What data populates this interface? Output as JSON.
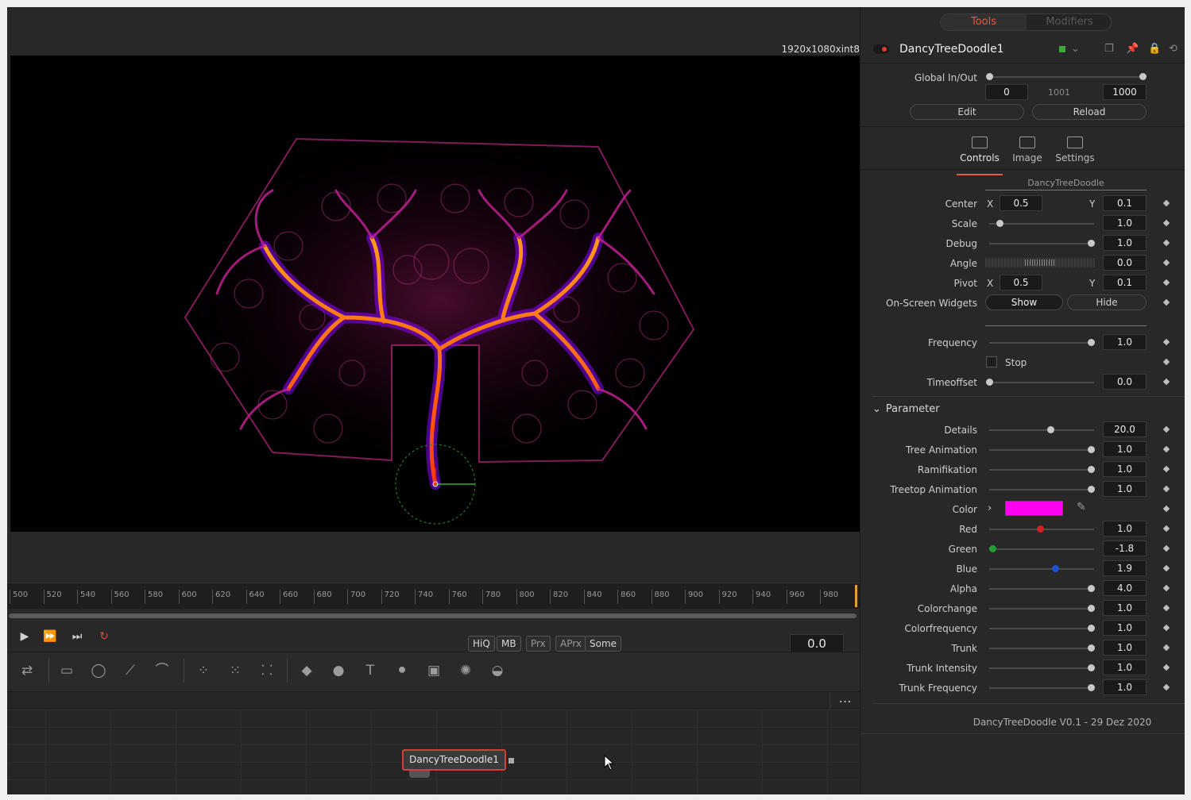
{
  "viewer": {
    "resolution": "1920x1080xint8",
    "ruler_ticks": [
      "500",
      "520",
      "540",
      "560",
      "580",
      "600",
      "620",
      "640",
      "660",
      "680",
      "700",
      "720",
      "740",
      "760",
      "780",
      "800",
      "820",
      "840",
      "860",
      "880",
      "900",
      "920",
      "940",
      "960",
      "980"
    ]
  },
  "transport": {
    "play_icon": "play-icon",
    "chips": [
      "HiQ",
      "MB",
      "Prx",
      "APrx",
      "Some"
    ],
    "time_value": "0.0"
  },
  "node": {
    "label": "DancyTreeDoodle1"
  },
  "inspector": {
    "tabs": {
      "tools": "Tools",
      "modifiers": "Modifiers"
    },
    "tool_name": "DancyTreeDoodle1",
    "global_inout": {
      "label": "Global In/Out",
      "start": "0",
      "mid": "1001",
      "end": "1000",
      "edit": "Edit",
      "reload": "Reload"
    },
    "subtabs": {
      "controls": "Controls",
      "image": "Image",
      "settings": "Settings"
    },
    "section_title": "DancyTreeDoodle",
    "center": {
      "label": "Center",
      "x_label": "X",
      "x": "0.5",
      "y_label": "Y",
      "y": "0.1"
    },
    "scale": {
      "label": "Scale",
      "value": "1.0",
      "level": 0.1
    },
    "debug": {
      "label": "Debug",
      "value": "1.0",
      "level": 1.0
    },
    "angle": {
      "label": "Angle",
      "value": "0.0"
    },
    "pivot": {
      "label": "Pivot",
      "x_label": "X",
      "x": "0.5",
      "y_label": "Y",
      "y": "0.1"
    },
    "widgets": {
      "label": "On-Screen Widgets",
      "show": "Show",
      "hide": "Hide"
    },
    "frequency": {
      "label": "Frequency",
      "value": "1.0",
      "level": 1.0
    },
    "stop": {
      "label": "Stop"
    },
    "timeoffset": {
      "label": "Timeoffset",
      "value": "0.0",
      "level": 0.0
    },
    "parameter_title": "Parameter",
    "params": [
      {
        "label": "Details",
        "value": "20.0",
        "level": 0.6,
        "color": "#c8c8c8"
      },
      {
        "label": "Tree Animation",
        "value": "1.0",
        "level": 1.0,
        "color": "#c8c8c8"
      },
      {
        "label": "Ramifikation",
        "value": "1.0",
        "level": 1.0,
        "color": "#c8c8c8"
      },
      {
        "label": "Treetop Animation",
        "value": "1.0",
        "level": 1.0,
        "color": "#c8c8c8"
      }
    ],
    "color": {
      "label": "Color",
      "swatch": "#ff00ee"
    },
    "color_params": [
      {
        "label": "Red",
        "value": "1.0",
        "level": 0.5,
        "color": "#d02020"
      },
      {
        "label": "Green",
        "value": "-1.8",
        "level": 0.03,
        "color": "#20a030"
      },
      {
        "label": "Blue",
        "value": "1.9",
        "level": 0.65,
        "color": "#2050d0"
      },
      {
        "label": "Alpha",
        "value": "4.0",
        "level": 1.0,
        "color": "#c8c8c8"
      },
      {
        "label": "Colorchange",
        "value": "1.0",
        "level": 1.0,
        "color": "#c8c8c8"
      },
      {
        "label": "Colorfrequency",
        "value": "1.0",
        "level": 1.0,
        "color": "#c8c8c8"
      },
      {
        "label": "Trunk",
        "value": "1.0",
        "level": 1.0,
        "color": "#c8c8c8"
      },
      {
        "label": "Trunk Intensity",
        "value": "1.0",
        "level": 1.0,
        "color": "#c8c8c8"
      },
      {
        "label": "Trunk Frequency",
        "value": "1.0",
        "level": 1.0,
        "color": "#c8c8c8"
      }
    ],
    "footer": "DancyTreeDoodle V0.1 - 29 Dez 2020"
  }
}
